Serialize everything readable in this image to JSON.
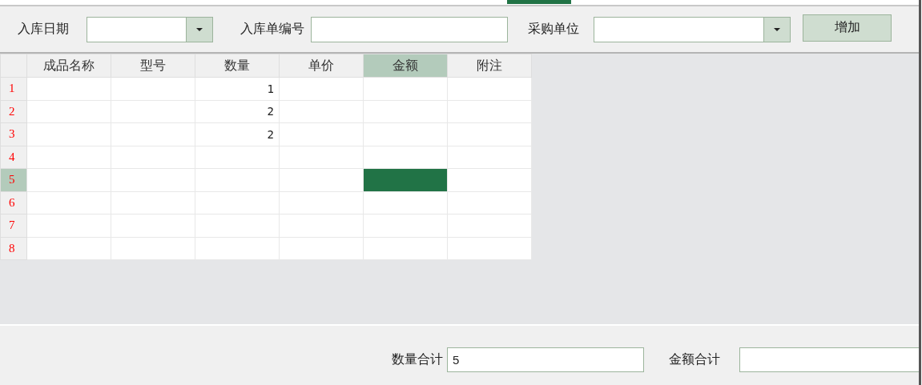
{
  "filters": [
    {
      "label": "入库日期",
      "kind": "combo"
    },
    {
      "label": "入库单编号",
      "kind": "text"
    },
    {
      "label": "采购单位",
      "kind": "combo"
    }
  ],
  "add_button": "增加",
  "table": {
    "columns": [
      {
        "label": "成品名称",
        "selected": false
      },
      {
        "label": "型号",
        "selected": false
      },
      {
        "label": "数量",
        "selected": false
      },
      {
        "label": "单价",
        "selected": false
      },
      {
        "label": "金额",
        "selected": true
      },
      {
        "label": "附注",
        "selected": false
      }
    ],
    "rows": [
      {
        "number": "1",
        "selected": false,
        "cells": [
          {
            "selected": false
          },
          {
            "selected": false
          },
          {
            "value": "1",
            "selected": false
          },
          {
            "selected": false
          },
          {
            "selected": false
          },
          {
            "selected": false
          }
        ]
      },
      {
        "number": "2",
        "selected": false,
        "cells": [
          {
            "selected": false
          },
          {
            "selected": false
          },
          {
            "value": "2",
            "selected": false
          },
          {
            "selected": false
          },
          {
            "selected": false
          },
          {
            "selected": false
          }
        ]
      },
      {
        "number": "3",
        "selected": false,
        "cells": [
          {
            "selected": false
          },
          {
            "selected": false
          },
          {
            "value": "2",
            "selected": false
          },
          {
            "selected": false
          },
          {
            "selected": false
          },
          {
            "selected": false
          }
        ]
      },
      {
        "number": "4",
        "selected": false,
        "cells": [
          {
            "selected": false
          },
          {
            "selected": false
          },
          {
            "selected": false
          },
          {
            "selected": false
          },
          {
            "selected": false
          },
          {
            "selected": false
          }
        ]
      },
      {
        "number": "5",
        "selected": true,
        "cells": [
          {
            "selected": false
          },
          {
            "selected": false
          },
          {
            "selected": false
          },
          {
            "selected": false
          },
          {
            "selected": true
          },
          {
            "selected": false
          }
        ]
      },
      {
        "number": "6",
        "selected": false,
        "cells": [
          {
            "selected": false
          },
          {
            "selected": false
          },
          {
            "selected": false
          },
          {
            "selected": false
          },
          {
            "selected": false
          },
          {
            "selected": false
          }
        ]
      },
      {
        "number": "7",
        "selected": false,
        "cells": [
          {
            "selected": false
          },
          {
            "selected": false
          },
          {
            "selected": false
          },
          {
            "selected": false
          },
          {
            "selected": false
          },
          {
            "selected": false
          }
        ]
      },
      {
        "number": "8",
        "selected": false,
        "cells": [
          {
            "selected": false
          },
          {
            "selected": false
          },
          {
            "selected": false
          },
          {
            "selected": false
          },
          {
            "selected": false
          },
          {
            "selected": false
          }
        ]
      }
    ]
  },
  "totals": [
    {
      "label": "数量合计",
      "value": "5"
    },
    {
      "label": "金额合计"
    }
  ]
}
